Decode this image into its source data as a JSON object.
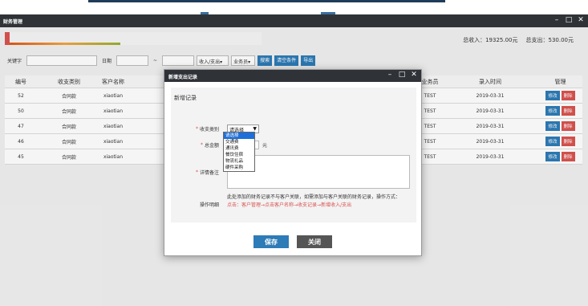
{
  "window": {
    "title": "财务管理"
  },
  "totals": {
    "income": "总收入：19325.00元",
    "expense": "总支出：530.00元"
  },
  "progress": {
    "fraction": 0.44
  },
  "toolbar": {
    "keyword_label": "关键字",
    "date_label": "日期",
    "date_sep": "~",
    "type_select": "收入/支出",
    "staff_select": "业务员",
    "search_btn": "搜索",
    "clear_btn": "清空条件",
    "export_btn": "导出"
  },
  "table": {
    "headers": {
      "id": "编号",
      "type": "收支类别",
      "customer": "客户名称",
      "staff": "业务员",
      "time": "录入时间",
      "manage": "管理"
    },
    "rows": [
      {
        "id": "52",
        "type": "合同款",
        "customer": "xiaotian",
        "staff": "TEST",
        "time": "2019-03-31"
      },
      {
        "id": "50",
        "type": "合同款",
        "customer": "xiaotian",
        "staff": "TEST",
        "time": "2019-03-31"
      },
      {
        "id": "47",
        "type": "合同款",
        "customer": "xiaotian",
        "staff": "TEST",
        "time": "2019-03-31"
      },
      {
        "id": "46",
        "type": "合同款",
        "customer": "xiaotian",
        "staff": "TEST",
        "time": "2019-03-31"
      },
      {
        "id": "45",
        "type": "合同款",
        "customer": "xiaotian",
        "staff": "TEST",
        "time": "2019-03-31"
      }
    ],
    "edit_label": "修改",
    "delete_label": "删除"
  },
  "modal": {
    "title": "新增支出记录",
    "section": "新增记录",
    "fields": {
      "category_label": "收支类别",
      "category_value": "请选择",
      "amount_label": "总金额",
      "amount_unit": "元",
      "remark_label": "详情备注",
      "action_label": "操作明细"
    },
    "dropdown_options": [
      "请选择",
      "交通费",
      "通讯费",
      "餐饮住宿",
      "物流礼品",
      "硬件采购"
    ],
    "help_text": "此处添加的财务记录不与客户关联，如需添加与客户关联的财务记录，操作方式：",
    "help_links": "点击：客户管理→点击客户名称→收支记录→新增收入/支出",
    "save": "保存",
    "close": "关闭"
  },
  "icons": {
    "minimize": "minimize-icon",
    "maximize": "maximize-icon",
    "close": "close-icon",
    "dropdown": "chevron-down-icon"
  },
  "colors": {
    "primary": "#2d7bb7",
    "danger": "#d9534f",
    "titlebar": "#2f3338"
  }
}
